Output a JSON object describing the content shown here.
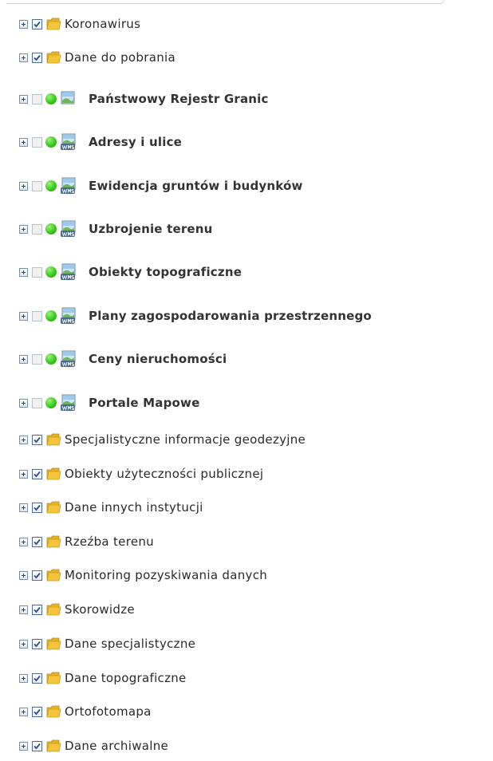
{
  "tree": {
    "items": [
      {
        "label": "Koronawirus",
        "kind": "folder",
        "checked": true
      },
      {
        "label": "Dane do pobrania",
        "kind": "folder",
        "checked": true
      },
      {
        "label": "Państwowy Rejestr Granic",
        "kind": "layer-map",
        "checked": false,
        "status": "active"
      },
      {
        "label": "Adresy i ulice",
        "kind": "layer-wms",
        "checked": false,
        "status": "active",
        "badge": "WMS"
      },
      {
        "label": "Ewidencja gruntów i budynków",
        "kind": "layer-wms",
        "checked": false,
        "status": "active",
        "badge": "WMS"
      },
      {
        "label": "Uzbrojenie terenu",
        "kind": "layer-wms",
        "checked": false,
        "status": "active",
        "badge": "WMS"
      },
      {
        "label": "Obiekty topograficzne",
        "kind": "layer-wms",
        "checked": false,
        "status": "active",
        "badge": "WMS"
      },
      {
        "label": "Plany zagospodarowania przestrzennego",
        "kind": "layer-wms",
        "checked": false,
        "status": "active",
        "badge": "WMS"
      },
      {
        "label": "Ceny nieruchomości",
        "kind": "layer-wms",
        "checked": false,
        "status": "active",
        "badge": "WMS"
      },
      {
        "label": "Portale Mapowe",
        "kind": "layer-wms",
        "checked": false,
        "status": "active",
        "badge": "WMS"
      },
      {
        "label": "Specjalistyczne informacje geodezyjne",
        "kind": "folder",
        "checked": true
      },
      {
        "label": "Obiekty użyteczności publicznej",
        "kind": "folder",
        "checked": true
      },
      {
        "label": "Dane innych instytucji",
        "kind": "folder",
        "checked": true
      },
      {
        "label": "Rzeźba terenu",
        "kind": "folder",
        "checked": true
      },
      {
        "label": "Monitoring pozyskiwania danych",
        "kind": "folder",
        "checked": true
      },
      {
        "label": "Skorowidze",
        "kind": "folder",
        "checked": true
      },
      {
        "label": "Dane specjalistyczne",
        "kind": "folder",
        "checked": true
      },
      {
        "label": "Dane topograficzne",
        "kind": "folder",
        "checked": true
      },
      {
        "label": "Ortofotomapa",
        "kind": "folder",
        "checked": true
      },
      {
        "label": "Dane archiwalne",
        "kind": "folder",
        "checked": true
      }
    ]
  },
  "colors": {
    "folder": "#f2c53d",
    "status_active": "#36c21a",
    "check_mark": "#2d4f86"
  },
  "icons": {
    "expand": "plus-box-icon",
    "folder": "folder-icon",
    "status": "green-dot-icon",
    "layer": "map-layer-icon"
  }
}
